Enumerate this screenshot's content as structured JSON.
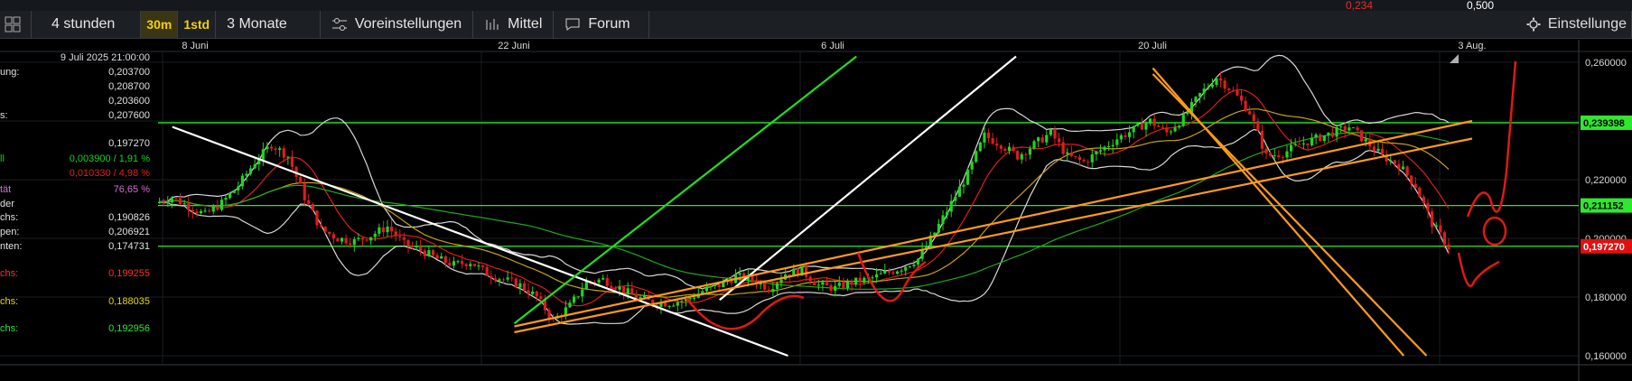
{
  "top_strip": {
    "value_red": "0,234",
    "value_white": "0,500"
  },
  "toolbar": {
    "period": "4 stunden",
    "tf_30m": "30m",
    "tf_1std": "1std",
    "range": "3 Monate",
    "presets": "Voreinstellungen",
    "indicator": "Mittel",
    "forum": "Forum",
    "settings": "Einstellunge"
  },
  "sidebar": {
    "date": "9 Juli 2025 21:00:00",
    "rows": [
      {
        "label": "ung:",
        "value": "0,203700",
        "color": "#e0e0e0"
      },
      {
        "label": "",
        "value": "0,208700",
        "color": "#e0e0e0"
      },
      {
        "label": "",
        "value": "0,203600",
        "color": "#e0e0e0"
      },
      {
        "label": "s:",
        "value": "0,207600",
        "color": "#e0e0e0"
      },
      {
        "label": "",
        "value": "0,197270",
        "color": "#e0e0e0"
      },
      {
        "label": "ll",
        "value": "0,003900 / 1,91 %",
        "color": "#19d219"
      },
      {
        "label": "",
        "value": "0,010330 / 4,98 %",
        "color": "#e02020"
      },
      {
        "label": "tät",
        "value": "76,65 %",
        "color": "#d070d0"
      },
      {
        "label": "der",
        "value": "",
        "color": "#e0e0e0"
      },
      {
        "label": "chs:",
        "value": "0,190826",
        "color": "#e0e0e0"
      },
      {
        "label": "pen:",
        "value": "0,206921",
        "color": "#e0e0e0"
      },
      {
        "label": "nten:",
        "value": "0,174731",
        "color": "#e0e0e0"
      },
      {
        "label": "chs:",
        "value": "0,199255",
        "color": "#ff3030"
      },
      {
        "label": "chs:",
        "value": "0,188035",
        "color": "#e8d800"
      },
      {
        "label": "chs:",
        "value": "0,192956",
        "color": "#2ee82e"
      }
    ]
  },
  "chart_data": {
    "type": "line",
    "subtype": "candlestick",
    "title": "",
    "x_tick_labels": [
      "8 Juni",
      "22 Juni",
      "6 Juli",
      "20 Juli",
      "3 Aug."
    ],
    "y_tick_labels": [
      "0,260000",
      "0,240000",
      "0,220000",
      "0,200000",
      "0,180000",
      "0,160000"
    ],
    "ylim": [
      0.16,
      0.262
    ],
    "grid": true,
    "price_flags": [
      {
        "text": "0,239398",
        "value": 0.2394,
        "color": "#2ee82e"
      },
      {
        "text": "0,211152",
        "value": 0.2112,
        "color": "#2ee82e"
      },
      {
        "text": "0,197270",
        "value": 0.1973,
        "color": "#e01010"
      }
    ],
    "horizontal_lines": [
      0.2394,
      0.2112,
      0.1973
    ],
    "close_series": [
      0.212,
      0.214,
      0.211,
      0.208,
      0.212,
      0.218,
      0.226,
      0.232,
      0.228,
      0.214,
      0.203,
      0.2,
      0.199,
      0.201,
      0.204,
      0.198,
      0.196,
      0.193,
      0.191,
      0.192,
      0.188,
      0.186,
      0.184,
      0.18,
      0.172,
      0.177,
      0.185,
      0.186,
      0.183,
      0.18,
      0.178,
      0.178,
      0.179,
      0.182,
      0.184,
      0.187,
      0.186,
      0.183,
      0.188,
      0.189,
      0.184,
      0.183,
      0.185,
      0.186,
      0.188,
      0.19,
      0.193,
      0.202,
      0.212,
      0.222,
      0.235,
      0.232,
      0.228,
      0.232,
      0.236,
      0.228,
      0.226,
      0.23,
      0.234,
      0.237,
      0.24,
      0.236,
      0.241,
      0.249,
      0.255,
      0.25,
      0.243,
      0.228,
      0.229,
      0.232,
      0.234,
      0.236,
      0.238,
      0.233,
      0.228,
      0.225,
      0.218,
      0.205,
      0.197
    ],
    "trendlines": [
      {
        "color": "#ffffff",
        "from": [
          "2025-06-07",
          0.238
        ],
        "to": [
          "2025-07-04",
          0.16
        ]
      },
      {
        "color": "#22dd22",
        "from": [
          "2025-06-22",
          0.171
        ],
        "to": [
          "2025-07-07",
          0.262
        ]
      },
      {
        "color": "#ffffff",
        "from": [
          "2025-07-01",
          0.179
        ],
        "to": [
          "2025-07-14",
          0.262
        ]
      },
      {
        "color": "#ff9a1a",
        "from": [
          "2025-06-22",
          0.17
        ],
        "to": [
          "2025-08-03",
          0.24
        ]
      },
      {
        "color": "#ff9a1a",
        "from": [
          "2025-06-22",
          0.168
        ],
        "to": [
          "2025-08-03",
          0.234
        ]
      },
      {
        "color": "#ff9a1a",
        "from": [
          "2025-07-20",
          0.258
        ],
        "to": [
          "2025-07-31",
          0.16
        ]
      },
      {
        "color": "#ff9a1a",
        "from": [
          "2025-07-20",
          0.256
        ],
        "to": [
          "2025-08-01",
          0.16
        ]
      }
    ]
  }
}
